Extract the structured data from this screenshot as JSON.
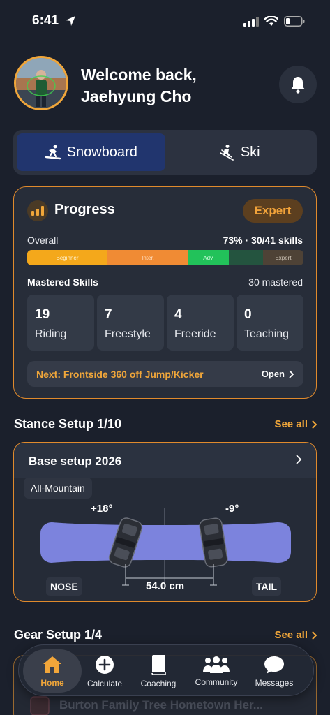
{
  "status_bar": {
    "time": "6:41"
  },
  "header": {
    "welcome_line1": "Welcome back,",
    "welcome_line2": "Jaehyung Cho"
  },
  "sport_toggle": {
    "tabs": [
      {
        "label": "Snowboard",
        "active": true
      },
      {
        "label": "Ski",
        "active": false
      }
    ]
  },
  "progress": {
    "title": "Progress",
    "level": "Expert",
    "overall_label": "Overall",
    "overall_value": "73% · 30/41 skills",
    "overall_fraction": 0.73,
    "level_segments": [
      "Beginner",
      "Inter.",
      "Adv.",
      "Expert"
    ],
    "mastered_label": "Mastered Skills",
    "mastered_count": "30 mastered",
    "skills": [
      {
        "count": "19",
        "label": "Riding"
      },
      {
        "count": "7",
        "label": "Freestyle"
      },
      {
        "count": "4",
        "label": "Freeride"
      },
      {
        "count": "0",
        "label": "Teaching"
      }
    ],
    "next_text": "Next: Frontside 360 off Jump/Kicker",
    "open_label": "Open"
  },
  "stance": {
    "section_title": "Stance Setup 1/10",
    "see_all": "See all",
    "setup_name": "Base setup 2026",
    "style": "All-Mountain",
    "front_angle": "+18°",
    "back_angle": "-9°",
    "nose_label": "NOSE",
    "tail_label": "TAIL",
    "width_label": "54.0 cm"
  },
  "gear": {
    "section_title": "Gear Setup 1/4",
    "see_all": "See all",
    "item_name": "Burton Family Tree Hometown Her..."
  },
  "tab_bar": {
    "items": [
      {
        "label": "Home",
        "icon": "home-icon",
        "active": true
      },
      {
        "label": "Calculate",
        "icon": "plus-circle-icon",
        "active": false
      },
      {
        "label": "Coaching",
        "icon": "book-icon",
        "active": false
      },
      {
        "label": "Community",
        "icon": "people-icon",
        "active": false
      },
      {
        "label": "Messages",
        "icon": "chat-bubble-icon",
        "active": false
      }
    ]
  },
  "colors": {
    "accent": "#f0a63a",
    "background": "#1b202c",
    "card": "#272d39",
    "active_tab": "#21356e",
    "board": "#7b82dc"
  }
}
